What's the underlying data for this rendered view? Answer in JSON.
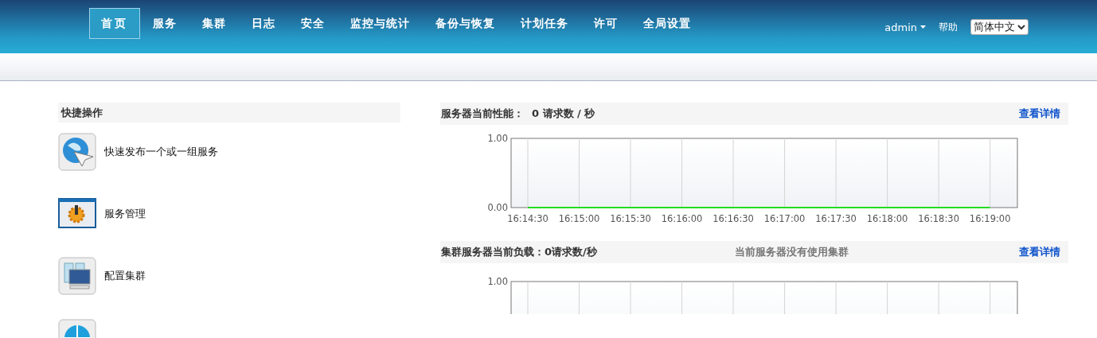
{
  "nav": {
    "items": [
      {
        "label": "首页",
        "selected": true
      },
      {
        "label": "服务",
        "selected": false
      },
      {
        "label": "集群",
        "selected": false
      },
      {
        "label": "日志",
        "selected": false
      },
      {
        "label": "安全",
        "selected": false
      },
      {
        "label": "监控与统计",
        "selected": false
      },
      {
        "label": "备份与恢复",
        "selected": false
      },
      {
        "label": "计划任务",
        "selected": false
      },
      {
        "label": "许可",
        "selected": false
      },
      {
        "label": "全局设置",
        "selected": false
      }
    ],
    "user": "admin",
    "help": "帮助",
    "language": "简体中文"
  },
  "quick_actions": {
    "title": "快捷操作",
    "items": [
      {
        "kind": "publish",
        "label": "快速发布一个或一组服务"
      },
      {
        "kind": "manage",
        "label": "服务管理"
      },
      {
        "kind": "cluster",
        "label": "配置集群"
      },
      {
        "kind": "globe"
      }
    ]
  },
  "panels": [
    {
      "title": "服务器当前性能：",
      "value": "0 请求数 / 秒",
      "link": "查看详情",
      "chart_data": {
        "type": "line",
        "x": [
          "16:14:30",
          "16:15:00",
          "16:15:30",
          "16:16:00",
          "16:16:30",
          "16:17:00",
          "16:17:30",
          "16:18:00",
          "16:18:30",
          "16:19:00"
        ],
        "ylim": [
          0,
          1
        ],
        "yticks": [
          {
            "value": 0,
            "label": "0.00"
          },
          {
            "value": 1,
            "label": "1.00"
          }
        ],
        "grid": true,
        "series": [
          {
            "color": "#22dd22",
            "values": [
              0,
              0,
              0,
              0,
              0,
              0,
              0,
              0,
              0,
              0
            ]
          }
        ]
      }
    },
    {
      "title": "集群服务器当前负载：",
      "value": "0请求数/秒",
      "note": "当前服务器没有使用集群",
      "link": "查看详情",
      "chart_label": "1.00"
    }
  ]
}
